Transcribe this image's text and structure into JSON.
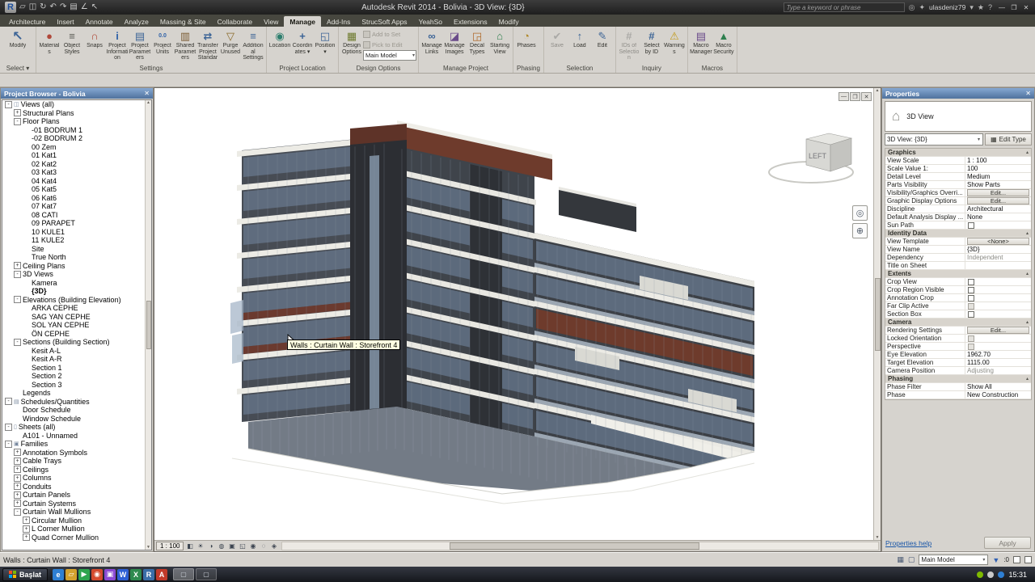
{
  "titlebar": {
    "title": "Autodesk Revit 2014 - Bolivia - 3D View: {3D}",
    "search_placeholder": "Type a keyword or phrase",
    "username": "ulasdeniz79",
    "quick_access_icons": [
      "open",
      "save",
      "sync",
      "undo",
      "redo",
      "print",
      "measure",
      "modify"
    ]
  },
  "ribbon": {
    "tabs": [
      "Architecture",
      "Insert",
      "Annotate",
      "Analyze",
      "Massing & Site",
      "Collaborate",
      "View",
      "Manage",
      "Add-Ins",
      "StrucSoft Apps",
      "YeahSo",
      "Extensions",
      "Modify"
    ],
    "active_tab": "Manage",
    "panels": [
      {
        "label": "Select",
        "arrow": true,
        "buttons": [
          {
            "label": "Modify",
            "icon": "modify",
            "big": true
          }
        ]
      },
      {
        "label": "Settings",
        "buttons": [
          {
            "label": "Materials",
            "icon": "materials"
          },
          {
            "label": "Object Styles",
            "icon": "object-styles"
          },
          {
            "label": "Snaps",
            "icon": "snaps"
          },
          {
            "label": "Project Information",
            "icon": "project-information"
          },
          {
            "label": "Project Parameters",
            "icon": "project-parameters"
          },
          {
            "label": "Project Units",
            "icon": "project-units"
          },
          {
            "label": "Shared Parameters",
            "icon": "shared-parameters"
          },
          {
            "label": "Transfer Project Standards",
            "icon": "transfer-project-standards"
          },
          {
            "label": "Purge Unused",
            "icon": "purge-unused"
          },
          {
            "label": "Additional Settings",
            "icon": "additional-settings",
            "dropdown": true
          }
        ]
      },
      {
        "label": "Project Location",
        "buttons": [
          {
            "label": "Location",
            "icon": "location"
          },
          {
            "label": "Coordinates",
            "icon": "coordinates",
            "dropdown": true
          },
          {
            "label": "Position",
            "icon": "position",
            "dropdown": true
          }
        ]
      },
      {
        "label": "Design Options",
        "buttons": [
          {
            "label": "Design Options",
            "icon": "design-options"
          }
        ],
        "extra": {
          "rows": [
            {
              "label": "Add to Set",
              "disabled": true
            },
            {
              "label": "Pick to Edit",
              "disabled": true
            }
          ],
          "combo": "Main Model"
        }
      },
      {
        "label": "Manage Project",
        "buttons": [
          {
            "label": "Manage Links",
            "icon": "manage-links"
          },
          {
            "label": "Manage Images",
            "icon": "manage-images"
          },
          {
            "label": "Decal Types",
            "icon": "decal-types"
          },
          {
            "label": "Starting View",
            "icon": "starting-view"
          }
        ]
      },
      {
        "label": "Phasing",
        "buttons": [
          {
            "label": "Phases",
            "icon": "phases"
          }
        ]
      },
      {
        "label": "Selection",
        "buttons": [
          {
            "label": "Save",
            "icon": "save-selection",
            "disabled": true
          },
          {
            "label": "Load",
            "icon": "load-selection"
          },
          {
            "label": "Edit",
            "icon": "edit-selection"
          }
        ]
      },
      {
        "label": "Inquiry",
        "buttons": [
          {
            "label": "IDs of Selection",
            "icon": "ids-of-selection",
            "disabled": true
          },
          {
            "label": "Select by ID",
            "icon": "select-by-id"
          },
          {
            "label": "Warnings",
            "icon": "warnings"
          }
        ]
      },
      {
        "label": "Macros",
        "buttons": [
          {
            "label": "Macro Manager",
            "icon": "macro-manager"
          },
          {
            "label": "Macro Security",
            "icon": "macro-security"
          }
        ]
      }
    ]
  },
  "project_browser": {
    "title": "Project Browser - Bolivia",
    "items": [
      {
        "label": "Views (all)",
        "level": 0,
        "expand": "minus",
        "icon": "views"
      },
      {
        "label": "Structural Plans",
        "level": 1,
        "expand": "plus"
      },
      {
        "label": "Floor Plans",
        "level": 1,
        "expand": "minus"
      },
      {
        "label": "-01 BODRUM 1",
        "level": 2
      },
      {
        "label": "-02 BODRUM 2",
        "level": 2
      },
      {
        "label": "00 Zem",
        "level": 2
      },
      {
        "label": "01 Kat1",
        "level": 2
      },
      {
        "label": "02 Kat2",
        "level": 2
      },
      {
        "label": "03 Kat3",
        "level": 2
      },
      {
        "label": "04 Kat4",
        "level": 2
      },
      {
        "label": "05 Kat5",
        "level": 2
      },
      {
        "label": "06 Kat6",
        "level": 2
      },
      {
        "label": "07 Kat7",
        "level": 2
      },
      {
        "label": "08 CATI",
        "level": 2
      },
      {
        "label": "09 PARAPET",
        "level": 2
      },
      {
        "label": "10 KULE1",
        "level": 2
      },
      {
        "label": "11 KULE2",
        "level": 2
      },
      {
        "label": "Site",
        "level": 2
      },
      {
        "label": "True North",
        "level": 2
      },
      {
        "label": "Ceiling Plans",
        "level": 1,
        "expand": "plus"
      },
      {
        "label": "3D Views",
        "level": 1,
        "expand": "minus"
      },
      {
        "label": "Kamera",
        "level": 2
      },
      {
        "label": "{3D}",
        "level": 2,
        "bold": true
      },
      {
        "label": "Elevations (Building Elevation)",
        "level": 1,
        "expand": "minus"
      },
      {
        "label": "ARKA CEPHE",
        "level": 2
      },
      {
        "label": "SAG YAN CEPHE",
        "level": 2
      },
      {
        "label": "SOL YAN CEPHE",
        "level": 2
      },
      {
        "label": "ÖN CEPHE",
        "level": 2
      },
      {
        "label": "Sections (Building Section)",
        "level": 1,
        "expand": "minus"
      },
      {
        "label": "Kesit A-L",
        "level": 2
      },
      {
        "label": "Kesit A-R",
        "level": 2
      },
      {
        "label": "Section 1",
        "level": 2
      },
      {
        "label": "Section 2",
        "level": 2
      },
      {
        "label": "Section 3",
        "level": 2
      },
      {
        "label": "Legends",
        "level": 1
      },
      {
        "label": "Schedules/Quantities",
        "level": 0,
        "expand": "minus",
        "icon": "schedules"
      },
      {
        "label": "Door Schedule",
        "level": 1
      },
      {
        "label": "Window Schedule",
        "level": 1
      },
      {
        "label": "Sheets (all)",
        "level": 0,
        "expand": "minus",
        "icon": "sheets"
      },
      {
        "label": "A101 - Unnamed",
        "level": 1
      },
      {
        "label": "Families",
        "level": 0,
        "expand": "minus",
        "icon": "families"
      },
      {
        "label": "Annotation Symbols",
        "level": 1,
        "expand": "plus"
      },
      {
        "label": "Cable Trays",
        "level": 1,
        "expand": "plus"
      },
      {
        "label": "Ceilings",
        "level": 1,
        "expand": "plus"
      },
      {
        "label": "Columns",
        "level": 1,
        "expand": "plus"
      },
      {
        "label": "Conduits",
        "level": 1,
        "expand": "plus"
      },
      {
        "label": "Curtain Panels",
        "level": 1,
        "expand": "plus"
      },
      {
        "label": "Curtain Systems",
        "level": 1,
        "expand": "plus"
      },
      {
        "label": "Curtain Wall Mullions",
        "level": 1,
        "expand": "minus"
      },
      {
        "label": "Circular Mullion",
        "level": 2,
        "expand": "plus"
      },
      {
        "label": "L Corner Mullion",
        "level": 2,
        "expand": "plus"
      },
      {
        "label": "Quad Corner Mullion",
        "level": 2,
        "expand": "plus"
      }
    ]
  },
  "properties": {
    "title": "Properties",
    "type_selector": "3D View",
    "instance_combo": "3D View: {3D}",
    "edit_type": "Edit Type",
    "rows": [
      {
        "section": "Graphics"
      },
      {
        "label": "View Scale",
        "value": "1 : 100"
      },
      {
        "label": "Scale Value 1:",
        "value": "100"
      },
      {
        "label": "Detail Level",
        "value": "Medium"
      },
      {
        "label": "Parts Visibility",
        "value": "Show Parts"
      },
      {
        "label": "Visibility/Graphics Overri...",
        "value": "Edit...",
        "control": "button"
      },
      {
        "label": "Graphic Display Options",
        "value": "Edit...",
        "control": "button"
      },
      {
        "label": "Discipline",
        "value": "Architectural"
      },
      {
        "label": "Default Analysis Display ...",
        "value": "None"
      },
      {
        "label": "Sun Path",
        "control": "checkbox"
      },
      {
        "section": "Identity Data"
      },
      {
        "label": "View Template",
        "value": "<None>",
        "control": "button"
      },
      {
        "label": "View Name",
        "value": "{3D}"
      },
      {
        "label": "Dependency",
        "value": "Independent",
        "disabled": true
      },
      {
        "label": "Title on Sheet",
        "value": ""
      },
      {
        "section": "Extents"
      },
      {
        "label": "Crop View",
        "control": "checkbox"
      },
      {
        "label": "Crop Region Visible",
        "control": "checkbox"
      },
      {
        "label": "Annotation Crop",
        "control": "checkbox"
      },
      {
        "label": "Far Clip Active",
        "control": "checkbox",
        "disabled": true
      },
      {
        "label": "Section Box",
        "control": "checkbox"
      },
      {
        "section": "Camera"
      },
      {
        "label": "Rendering Settings",
        "value": "Edit...",
        "control": "button"
      },
      {
        "label": "Locked Orientation",
        "control": "checkbox",
        "disabled": true
      },
      {
        "label": "Perspective",
        "control": "checkbox",
        "disabled": true
      },
      {
        "label": "Eye Elevation",
        "value": "1962.70"
      },
      {
        "label": "Target Elevation",
        "value": "1115.00"
      },
      {
        "label": "Camera Position",
        "value": "Adjusting",
        "disabled": true
      },
      {
        "section": "Phasing"
      },
      {
        "label": "Phase Filter",
        "value": "Show All"
      },
      {
        "label": "Phase",
        "value": "New Construction"
      }
    ],
    "help_link": "Properties help",
    "apply_label": "Apply"
  },
  "viewport": {
    "tooltip": "Walls : Curtain Wall : Storefront 4",
    "viewcube_face": "LEFT",
    "scale": "1 : 100",
    "view_control_icons": [
      "visual-style",
      "sun-path",
      "shadows",
      "rendering-dialog",
      "crop-view",
      "crop-region",
      "temporary-hide-isolate",
      "reveal-hidden",
      "unlocked-view"
    ],
    "nav_icons": [
      "steering-wheel",
      "zoom"
    ]
  },
  "statusbar": {
    "message": "Walls : Curtain Wall : Storefront 4",
    "main_model": "Main Model",
    "filter_count": ":0"
  },
  "taskbar": {
    "start_label": "Başlat",
    "time": "15:31",
    "quick_launch_icons": [
      "internet-explorer",
      "file-explorer",
      "media-player",
      "chrome",
      "photo-viewer",
      "word",
      "excel",
      "revit",
      "autocad"
    ],
    "app_buttons": [
      "revit-window",
      "folder-window"
    ]
  }
}
